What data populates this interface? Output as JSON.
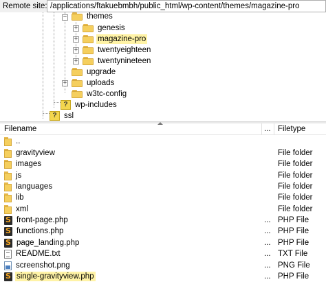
{
  "remote_site": {
    "label": "Remote site:",
    "path": "/applications/ftakuebmbh/public_html/wp-content/themes/magazine-pro"
  },
  "tree": [
    {
      "name": "themes",
      "icon": "folder-icon",
      "expander": "minus",
      "highlight": false
    },
    {
      "name": "genesis",
      "icon": "folder-icon",
      "expander": "plus",
      "highlight": false
    },
    {
      "name": "magazine-pro",
      "icon": "folder-icon",
      "expander": "plus",
      "highlight": true
    },
    {
      "name": "twentyeighteen",
      "icon": "folder-icon",
      "expander": "plus",
      "highlight": false
    },
    {
      "name": "twentynineteen",
      "icon": "folder-icon",
      "expander": "plus",
      "highlight": false
    },
    {
      "name": "upgrade",
      "icon": "folder-icon",
      "expander": "none",
      "highlight": false
    },
    {
      "name": "uploads",
      "icon": "folder-icon",
      "expander": "plus",
      "highlight": false
    },
    {
      "name": "w3tc-config",
      "icon": "folder-icon",
      "expander": "none",
      "highlight": false
    },
    {
      "name": "wp-includes",
      "icon": "unknown-folder-icon",
      "expander": "none",
      "highlight": false
    },
    {
      "name": "ssl",
      "icon": "unknown-folder-icon",
      "expander": "none",
      "highlight": false
    }
  ],
  "columns": {
    "filename": "Filename",
    "filesize": "...",
    "filetype": "Filetype"
  },
  "files": [
    {
      "name": "..",
      "icon": "folder-icon",
      "size": "",
      "type": "",
      "highlight": false
    },
    {
      "name": "gravityview",
      "icon": "folder-icon",
      "size": "",
      "type": "File folder",
      "highlight": false
    },
    {
      "name": "images",
      "icon": "folder-icon",
      "size": "",
      "type": "File folder",
      "highlight": false
    },
    {
      "name": "js",
      "icon": "folder-icon",
      "size": "",
      "type": "File folder",
      "highlight": false
    },
    {
      "name": "languages",
      "icon": "folder-icon",
      "size": "",
      "type": "File folder",
      "highlight": false
    },
    {
      "name": "lib",
      "icon": "folder-icon",
      "size": "",
      "type": "File folder",
      "highlight": false
    },
    {
      "name": "xml",
      "icon": "folder-icon",
      "size": "",
      "type": "File folder",
      "highlight": false
    },
    {
      "name": "front-page.php",
      "icon": "php-file-icon",
      "size": "...",
      "type": "PHP File",
      "highlight": false
    },
    {
      "name": "functions.php",
      "icon": "php-file-icon",
      "size": "...",
      "type": "PHP File",
      "highlight": false
    },
    {
      "name": "page_landing.php",
      "icon": "php-file-icon",
      "size": "...",
      "type": "PHP File",
      "highlight": false
    },
    {
      "name": "README.txt",
      "icon": "text-file-icon",
      "size": "...",
      "type": "TXT File",
      "highlight": false
    },
    {
      "name": "screenshot.png",
      "icon": "image-file-icon",
      "size": "...",
      "type": "PNG File",
      "highlight": false
    },
    {
      "name": "single-gravityview.php",
      "icon": "php-file-icon",
      "size": "...",
      "type": "PHP File",
      "highlight": true
    }
  ],
  "colors": {
    "highlight": "#fff3a6",
    "folder": "#f5cf5e",
    "unknown_folder": "#f3d64e"
  }
}
